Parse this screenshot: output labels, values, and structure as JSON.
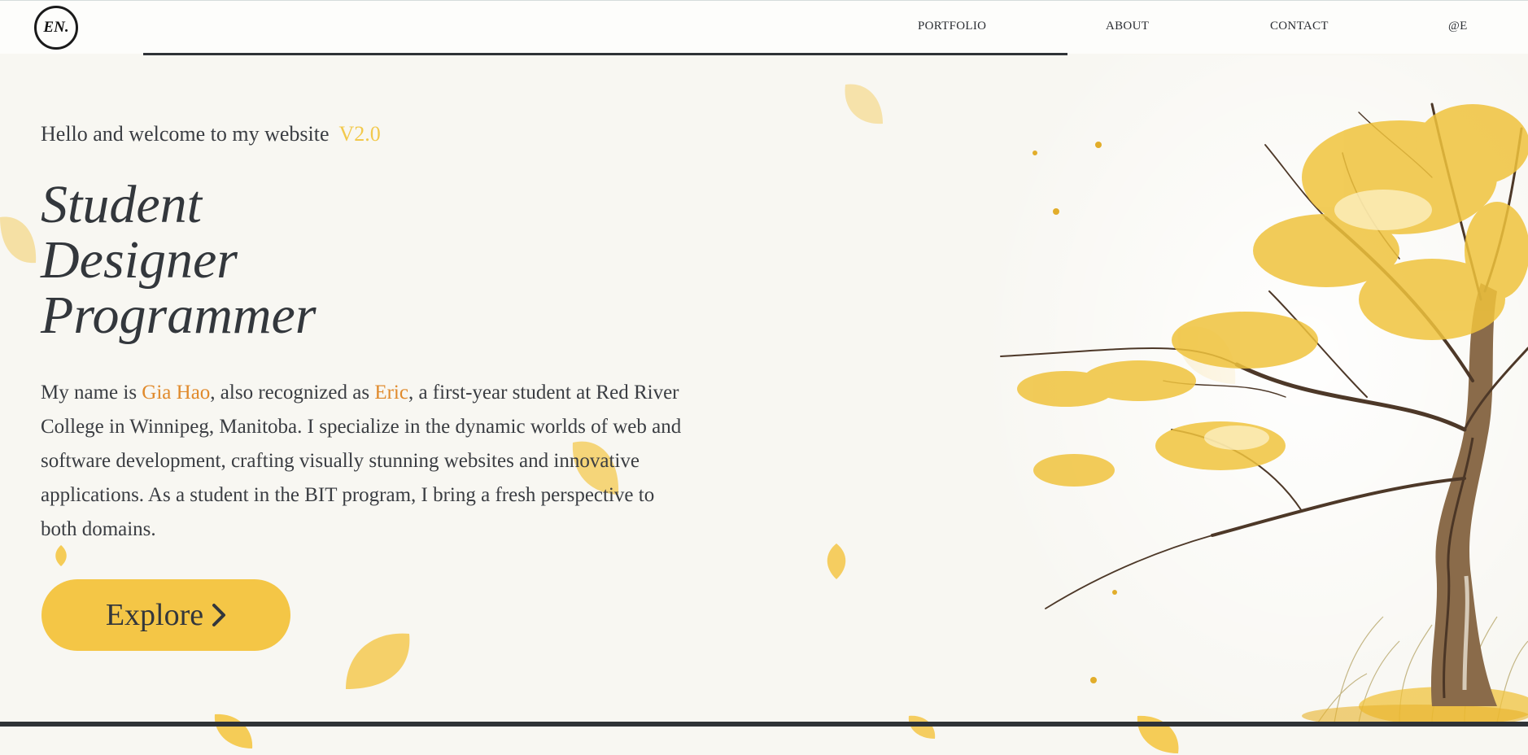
{
  "header": {
    "logo_text": "EN.",
    "nav": {
      "portfolio": "PORTFOLIO",
      "about": "ABOUT",
      "contact": "CONTACT",
      "handle": "@E"
    }
  },
  "hero": {
    "welcome": "Hello and welcome to my website",
    "version": "V2.0",
    "roles": [
      "Student",
      "Designer",
      "Programmer"
    ],
    "bio": {
      "p1": "My name is ",
      "name1": "Gia Hao",
      "p2": ", also recognized as ",
      "name2": "Eric",
      "p3": ", a first-year student at Red River College in Winnipeg, Manitoba. I specialize in the dynamic worlds of web and software development, crafting visually stunning websites and innovative applications. As a student in the BIT program, I bring a fresh perspective to both domains."
    },
    "explore_label": "Explore"
  },
  "colors": {
    "accent": "#f4c646",
    "highlight": "#e08a2c",
    "text": "#3a3d42",
    "background": "#f8f7f2"
  },
  "icons": {
    "explore": "chevron-right-icon",
    "decor": "falling-leaf-icon",
    "illustration": "autumn-tree"
  }
}
